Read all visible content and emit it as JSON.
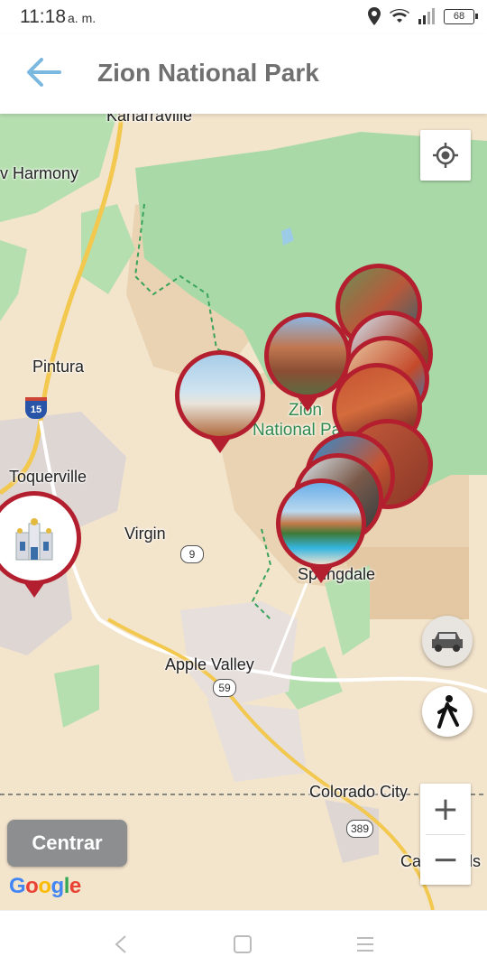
{
  "status_bar": {
    "time": "11:18",
    "meridiem": "a. m.",
    "battery": "68"
  },
  "app_bar": {
    "title": "Zion National Park",
    "back_icon": "arrow-left-icon"
  },
  "map": {
    "labels": {
      "kanarraville": "Kanarraville",
      "new_harmony": "v Harmony",
      "pintura": "Pintura",
      "toquerville": "Toquerville",
      "virgin": "Virgin",
      "zion_line1": "Zion",
      "zion_line2": "National Park",
      "springdale": "Springdale",
      "apple_valley": "Apple Valley",
      "colorado_city": "Colorado City",
      "cane_beds": "Cane Beds"
    },
    "shields": {
      "i15": "15",
      "r9": "9",
      "r59": "59",
      "r389": "389"
    },
    "accent_color": "#b31f2e"
  },
  "controls": {
    "locate_icon": "my-location-icon",
    "car_icon": "car-icon",
    "walk_icon": "walking-person-icon",
    "zoom_in": "+",
    "zoom_out": "−",
    "center_label": "Centrar",
    "google_letters": [
      "G",
      "o",
      "o",
      "g",
      "l",
      "e"
    ]
  }
}
